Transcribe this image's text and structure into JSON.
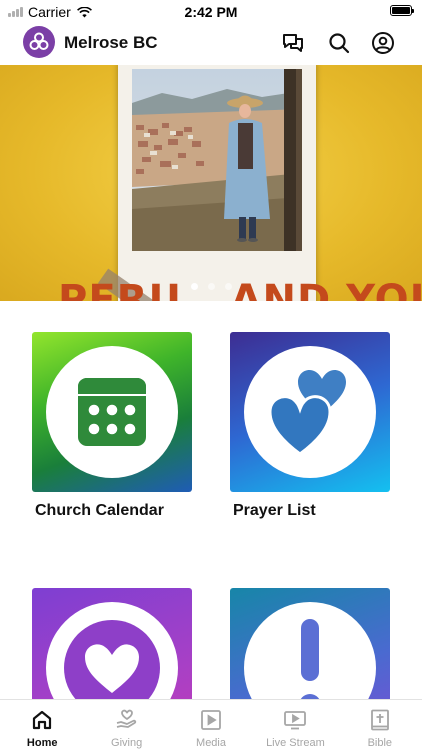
{
  "status_bar": {
    "carrier": "Carrier",
    "time": "2:42 PM"
  },
  "header": {
    "title": "Melrose BC",
    "icons": [
      "chat-icon",
      "search-icon",
      "profile-icon"
    ]
  },
  "hero": {
    "banner_text": "PERU...AND YOU!",
    "slides": 3,
    "active_slide": 1
  },
  "tiles": [
    {
      "label": "Church Calendar",
      "icon": "calendar-icon",
      "gradient": [
        "#8ee02c",
        "#1a8a2a",
        "#1d5fb4"
      ]
    },
    {
      "label": "Prayer List",
      "icon": "hearts-icon",
      "gradient": [
        "#4a2fa0",
        "#2a7ee0",
        "#16b9ee"
      ]
    },
    {
      "label": "",
      "icon": "heart-bubble-icon",
      "gradient": [
        "#8a3cc8",
        "#b13fc0"
      ]
    },
    {
      "label": "",
      "icon": "exclamation-icon",
      "gradient": [
        "#1e7fb0",
        "#7a4ed0"
      ]
    }
  ],
  "tab_bar": {
    "tabs": [
      {
        "label": "Home",
        "icon": "home-icon",
        "active": true
      },
      {
        "label": "Giving",
        "icon": "giving-icon",
        "active": false
      },
      {
        "label": "Media",
        "icon": "media-icon",
        "active": false
      },
      {
        "label": "Live Stream",
        "icon": "live-stream-icon",
        "active": false
      },
      {
        "label": "Bible",
        "icon": "bible-icon",
        "active": false
      }
    ]
  },
  "colors": {
    "brand": "#7b3fa6",
    "hero_background": "#e8be2e",
    "banner_text": "#c44a1c",
    "tab_active": "#111111",
    "tab_inactive": "#a6a6a6"
  }
}
